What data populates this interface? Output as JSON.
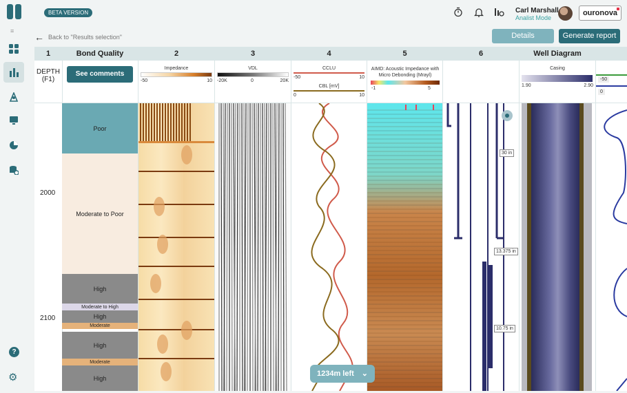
{
  "header": {
    "beta_label": "BETA VERSION",
    "user_name": "Carl Marshall",
    "user_role": "Analist Mode",
    "brand": "ouronova",
    "back_label": "Back to \"Results selection\"",
    "details_label": "Details",
    "report_label": "Generate report"
  },
  "sidebar": {
    "items": [
      {
        "name": "dashboard-icon",
        "glyph": "▦"
      },
      {
        "name": "bar-chart-icon",
        "glyph": "▮"
      },
      {
        "name": "rig-icon",
        "glyph": "⟁"
      },
      {
        "name": "monitor-icon",
        "glyph": "▣"
      },
      {
        "name": "pie-chart-icon",
        "glyph": "◕"
      },
      {
        "name": "database-icon",
        "glyph": "⛁"
      }
    ],
    "help_glyph": "?",
    "settings_glyph": "⚙"
  },
  "columns": {
    "c1": "1",
    "bond": "Bond Quality",
    "c2": "2",
    "c3": "3",
    "c4": "4",
    "c5": "5",
    "c6": "6",
    "well": "Well Diagram"
  },
  "subheaders": {
    "depth": "DEPTH",
    "depth_unit": "(F1)",
    "see_comments": "See comments",
    "impedance": {
      "title": "Impedance",
      "min": "-50",
      "max": "10"
    },
    "vdl": {
      "title": "VDL",
      "min": "-20K",
      "mid": "0",
      "max": "20K"
    },
    "cclu": {
      "title": "CCLU",
      "min": "-50",
      "max": "10"
    },
    "cbl": {
      "title": "CBL [mV]",
      "min": "0",
      "max": "10"
    },
    "aimd": {
      "title": "AIMD: Acoustic Impedance with Micro Debonding (Mrayl)",
      "min": "-1",
      "max": "5"
    },
    "casing": {
      "title": "Casing",
      "min": "1.90",
      "max": "2.90"
    },
    "extra": {
      "a": "-50",
      "b": "0"
    }
  },
  "depths": [
    "2000",
    "2100"
  ],
  "bond_quality": [
    {
      "label": "Poor",
      "color": "#6aa9b3"
    },
    {
      "label": "Moderate to Poor",
      "color": "#f8ece0"
    },
    {
      "label": "High",
      "color": "#8a8a8a"
    },
    {
      "label": "Moderate to High",
      "color": "#dcd7e8"
    },
    {
      "label": "High",
      "color": "#8a8a8a"
    },
    {
      "label": "Moderate",
      "color": "#e5b27a"
    },
    {
      "label": "High",
      "color": "#8a8a8a"
    },
    {
      "label": "Moderate",
      "color": "#e5b27a"
    },
    {
      "label": "High",
      "color": "#8a8a8a"
    }
  ],
  "casing_labels": [
    "30 in",
    "13.375 in",
    "10.75 in"
  ],
  "remaining_label": "1234m left",
  "colors": {
    "accent": "#2b6c78",
    "accent_light": "#7fb3bd",
    "header_bg": "#d9e5e6"
  }
}
